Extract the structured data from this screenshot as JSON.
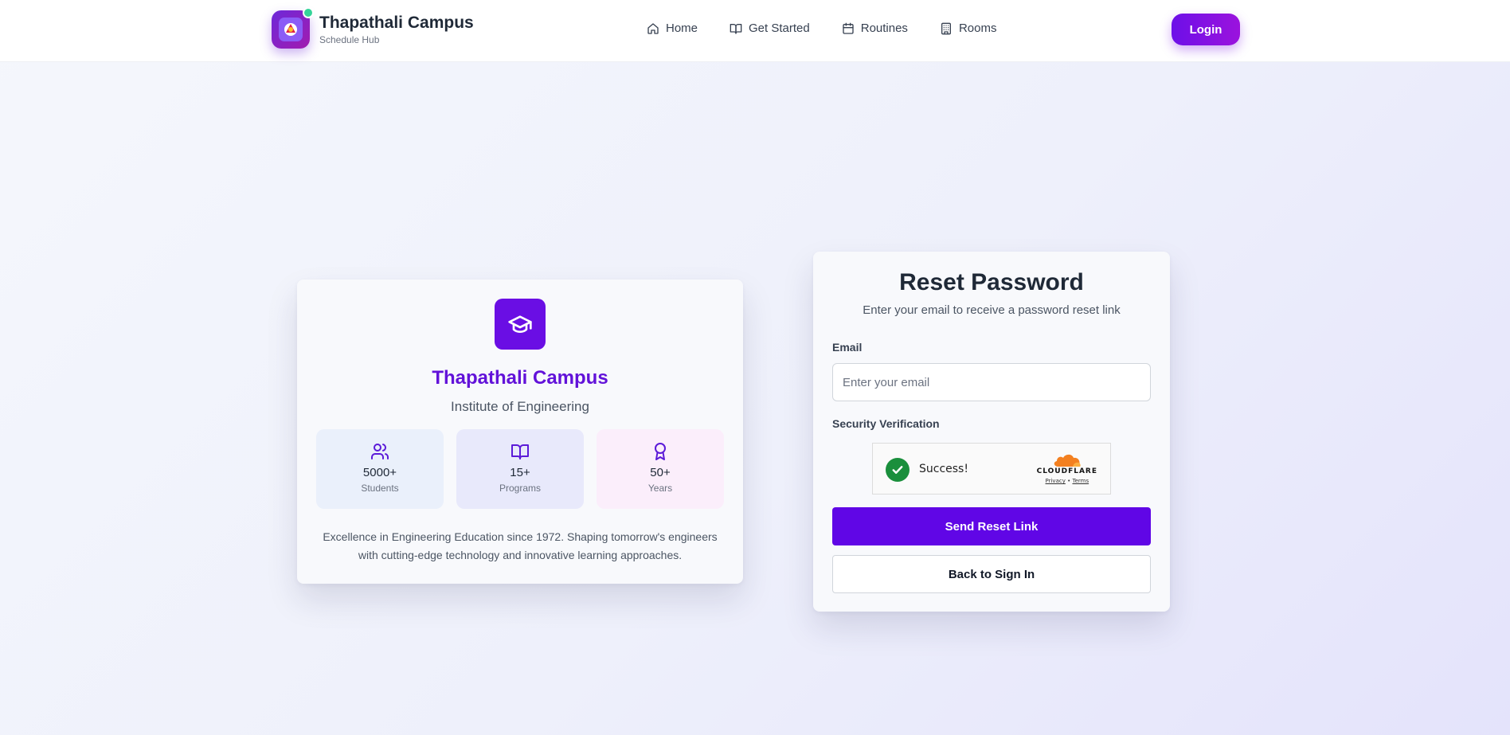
{
  "header": {
    "brand_title": "Thapathali Campus",
    "brand_subtitle": "Schedule Hub",
    "nav": [
      {
        "label": "Home",
        "icon": "home-icon"
      },
      {
        "label": "Get Started",
        "icon": "book-open-icon"
      },
      {
        "label": "Routines",
        "icon": "calendar-icon"
      },
      {
        "label": "Rooms",
        "icon": "building-icon"
      }
    ],
    "login_label": "Login"
  },
  "info_card": {
    "icon": "graduation-cap-icon",
    "title": "Thapathali Campus",
    "subtitle": "Institute of Engineering",
    "stats": [
      {
        "value": "5000+",
        "label": "Students",
        "icon": "users-icon"
      },
      {
        "value": "15+",
        "label": "Programs",
        "icon": "book-open-icon"
      },
      {
        "value": "50+",
        "label": "Years",
        "icon": "award-icon"
      }
    ],
    "description": "Excellence in Engineering Education since 1972. Shaping tomorrow's engineers with cutting-edge technology and innovative learning approaches."
  },
  "reset_form": {
    "title": "Reset Password",
    "subtitle": "Enter your email to receive a password reset link",
    "email_label": "Email",
    "email_placeholder": "Enter your email",
    "email_value": "",
    "verification_label": "Security Verification",
    "captcha": {
      "status": "Success!",
      "brand": "CLOUDFLARE",
      "privacy_link": "Privacy",
      "separator": "•",
      "terms_link": "Terms"
    },
    "submit_label": "Send Reset Link",
    "back_label": "Back to Sign In"
  },
  "colors": {
    "primary": "#6006e6",
    "brand_title": "#6212d9",
    "success": "#1a8f3c",
    "cloudflare_orange": "#f38020"
  }
}
